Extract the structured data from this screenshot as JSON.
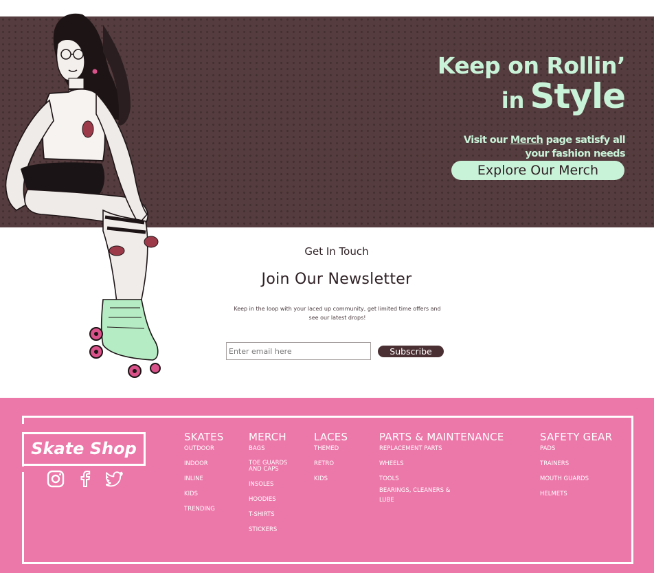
{
  "hero": {
    "headline_1": "Keep on Rollin’",
    "headline_in": "in",
    "headline_style": "Style",
    "sub_prefix": "Visit our ",
    "sub_link": "Merch",
    "sub_suffix": " page satisfy all",
    "sub_line2": "your fashion needs",
    "cta": "Explore Our Merch",
    "colors": {
      "background": "#553c3e",
      "accent": "#c9f3d9"
    }
  },
  "newsletter": {
    "label": "Get In Touch",
    "title": "Join Our Newsletter",
    "description": "Keep in the loop with your laced up community, get limited time offers and see our latest drops!",
    "email_placeholder": "Enter email here",
    "subscribe": "Subscribe"
  },
  "footer": {
    "logo": "Skate Shop",
    "socials": [
      "instagram-icon",
      "facebook-icon",
      "twitter-icon"
    ],
    "colors": {
      "background": "#ec77a9",
      "text": "#ffffff"
    },
    "columns": [
      {
        "title": "SKATES",
        "items": [
          "OUTDOOR",
          "INDOOR",
          "INLINE",
          "KIDS",
          "TRENDING"
        ]
      },
      {
        "title": "MERCH",
        "items": [
          "BAGS",
          "TOE GUARDS AND CAPS",
          "INSOLES",
          "HOODIES",
          "T-SHIRTS",
          "STICKERS"
        ]
      },
      {
        "title": "LACES",
        "items": [
          "THEMED",
          "RETRO",
          "KIDS"
        ]
      },
      {
        "title": "PARTS & MAINTENANCE",
        "items": [
          "REPLACEMENT PARTS",
          "WHEELS",
          "TOOLS",
          "BEARINGS, CLEANERS & LUBE"
        ]
      },
      {
        "title": "SAFETY GEAR",
        "items": [
          "PADS",
          "TRAINERS",
          "MOUTH GUARDS",
          "HELMETS"
        ]
      }
    ]
  }
}
